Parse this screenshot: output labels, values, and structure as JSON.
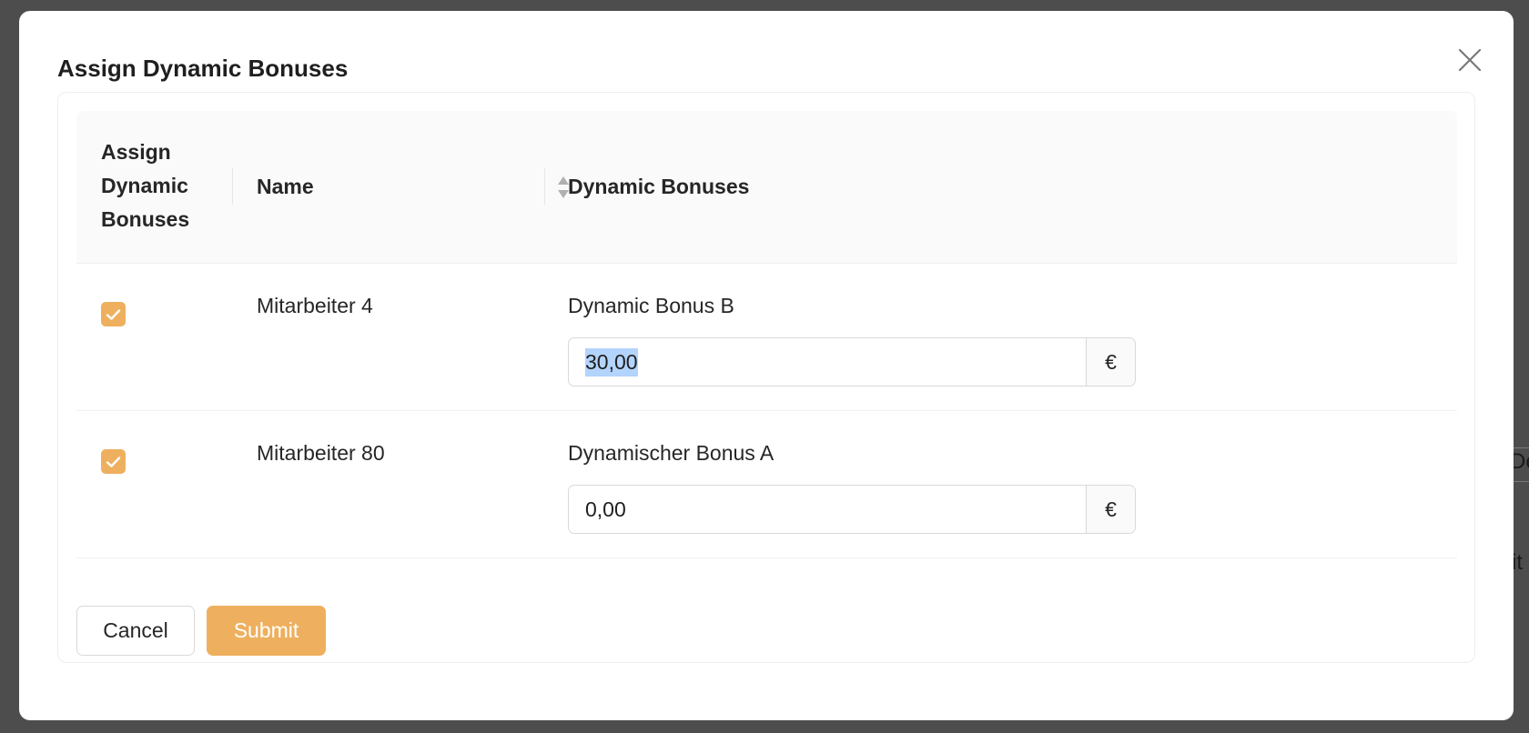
{
  "background": {
    "partial_texts": [
      "De",
      "it"
    ]
  },
  "modal": {
    "title": "Assign Dynamic Bonuses",
    "close_icon": "close-icon"
  },
  "table": {
    "headers": {
      "assign": "Assign Dynamic Bonuses",
      "name": "Name",
      "bonuses": "Dynamic Bonuses"
    },
    "sort_icon": "sort-icon",
    "rows": [
      {
        "checked": true,
        "name": "Mitarbeiter 4",
        "bonus_label": "Dynamic Bonus B",
        "amount": "30,00",
        "currency": "€",
        "amount_selected": true
      },
      {
        "checked": true,
        "name": "Mitarbeiter 80",
        "bonus_label": "Dynamischer Bonus A",
        "amount": "0,00",
        "currency": "€",
        "amount_selected": false
      }
    ]
  },
  "actions": {
    "cancel_label": "Cancel",
    "submit_label": "Submit"
  },
  "colors": {
    "accent": "#eeb05e",
    "overlay": "#4d4d4d",
    "selection": "#b3d4fc"
  }
}
